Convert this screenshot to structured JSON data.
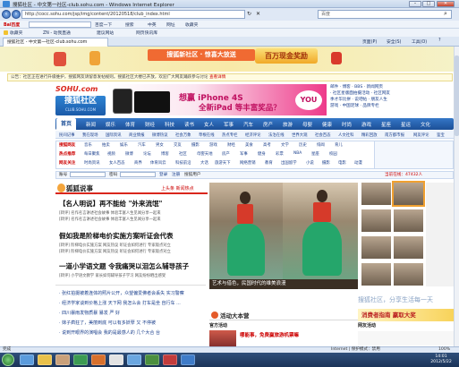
{
  "window": {
    "title": "搜狐社区 - 中文第一社区-club.sohu.com - Windows Internet Explorer",
    "min": "–",
    "max": "□",
    "close": "✕"
  },
  "address": {
    "url": "http://cocc.sohu.com/jsp/img/content/20120518/club_index.html",
    "search_placeholder": "百度"
  },
  "toolbar": {
    "row1": [
      "百度一下",
      "搜索",
      "中英",
      "网址",
      "收藏夹"
    ],
    "row2_favorites": "收藏夹",
    "row2_items": [
      "ZN - 动我直通",
      "建议网站",
      "网页快讯库"
    ],
    "right_items": [
      "页面(P)",
      "安全(S)",
      "工具(O)",
      "?"
    ]
  },
  "tab": {
    "label": "搜狐社区 - 中文第一社区-club.sohu.com"
  },
  "banner": {
    "ribbon": "搜狐新社区 · 惊喜大放送",
    "gold": "百万现金奖励"
  },
  "notice": {
    "text": "公告：社区正在进行升级维护，搜狐网友请留意发帖规则。搜狐社区大楼已开放，欢迎广大网友踊跃参与讨论",
    "link": "查看详情"
  },
  "logo": {
    "sohu": "SOHU.com",
    "club": "搜狐社区",
    "club_sub": "CLUB.SOHU.COM"
  },
  "ad": {
    "title": "想赢 iPhone 4S",
    "subtitle": "全新iPad 等丰富奖品？",
    "badge": "YOU"
  },
  "right_links": [
    "邮件 · 博客 · BBS · 新闻网页",
    "· 社区星版面拍摄活动 · 社区网友",
    "季才华比拼 · 说吧帖 · 朋友人生",
    "游戏 · 中国足球 · 品牌专栏"
  ],
  "nav": {
    "home": "首页",
    "items": [
      "新闻",
      "娱乐",
      "体育",
      "财经",
      "科技",
      "读书",
      "女人",
      "军事",
      "汽车",
      "房产",
      "旅游",
      "母婴",
      "健康",
      "时尚",
      "游戏",
      "星座",
      "星运",
      "文化"
    ]
  },
  "subnav": [
    "民间记事",
    "我在现场",
    "国际资讯",
    "商业情报",
    "微博热议",
    "社会万象",
    "草根在线",
    "热点专栏",
    "经济评论",
    "法治在线",
    "世界大观",
    "社会百态",
    "人文社科",
    "精彩回放",
    "南方都市报",
    "网友评论",
    "鉴宝"
  ],
  "grid": {
    "rows": [
      {
        "label": "搜狐网友",
        "items": [
          "音乐",
          "拍卖",
          "娱乐",
          "汽车",
          "男女",
          "交友",
          "摄影",
          "游戏",
          "财经",
          "美食",
          "高考",
          "文学",
          "历史",
          "绯闻",
          "育儿"
        ]
      },
      {
        "label": "热点推荐",
        "items": [
          "每日聚焦",
          "视频",
          "微博",
          "论坛",
          "博客",
          "社区",
          "母婴天地",
          "房产",
          "军事",
          "健身",
          "彩票",
          "NBA",
          "星座",
          "校园"
        ]
      },
      {
        "label": "网友关注",
        "items": [
          "时尚资讯",
          "女人百态",
          "商界",
          "体育风云",
          "科技前沿",
          "大话",
          "旅游天下",
          "网络营销",
          "教育",
          "出国留学",
          "小说",
          "摄影",
          "电影",
          "动漫"
        ]
      }
    ]
  },
  "login": {
    "text": "账号",
    "pwd": "密码",
    "btn_login": "登录",
    "btn_reg": "注册",
    "user": "搜狐用户",
    "online": "当前在线：47432人"
  },
  "fox": {
    "title": "狐狐说事",
    "more": "上头条 新闻热点"
  },
  "news": [
    {
      "headline": "【名人明说】再不能给 \"外来流氓\"",
      "sub": "[转评] 名作名言讲述社会故事 体验丰富人生见闻分享一起来"
    },
    {
      "headline": "假如我是阶梯电价实施方案听证会代表",
      "sub": "[转评] 阶梯电价实施方案 网友热议 听证会如何进行 专家观点对立"
    },
    {
      "headline": "一道小学语文题 令我痛哭以泪怎么辅导孩子",
      "sub": "[转评] 小学语文教学 家长如何辅导孩子学习 网友纷纷晒出感受"
    }
  ],
  "bullets": [
    "· 张红拍摄被着连体的照片公开，众望偏爱佛者会丢失 实习警察",
    "· 经济学家谈到价格上涨 天下网 我怎么会 打车是坐 自行车 ...",
    "· 四川暴雨发物质暴 暴发 严 好",
    "· 妹子疯狂了，美丽到底 可以有多妖孽 又 不停被 ",
    "· 说到开眼界的演唱会 我的是最感人的 几个大合 台"
  ],
  "photo": {
    "caption": "艺术与借色，民国时代的维美浪漫"
  },
  "slogan": "搜狐社区，分享生活每一天",
  "activity": {
    "title": "活动大本营",
    "official": "官方活动",
    "featured": "哪能事，免费赢旅游机票嘛",
    "net": "网友活动",
    "promo": "消费者指南 赢取大奖"
  },
  "status": {
    "left": "完成",
    "zone": "Internet | 保护模式：禁用",
    "zoom": "100%"
  },
  "taskbar": {
    "time": "14:01",
    "date": "2012/5/22"
  }
}
